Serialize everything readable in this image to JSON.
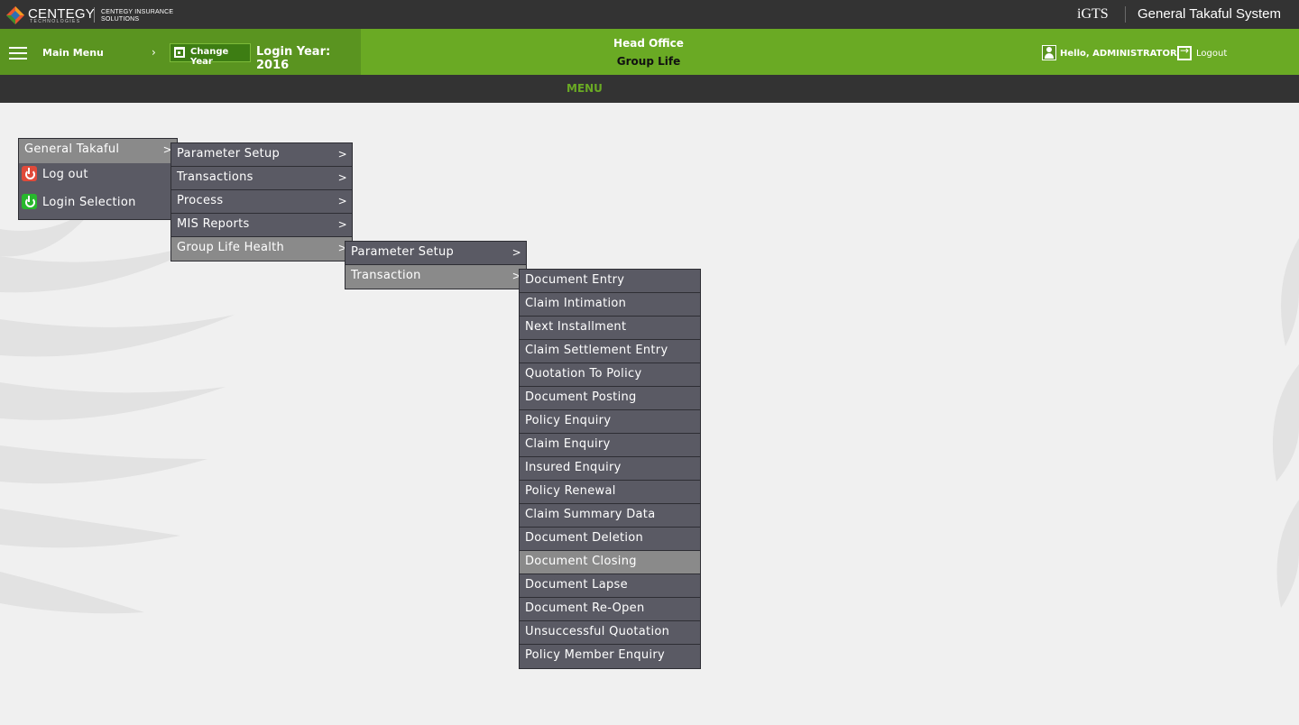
{
  "header": {
    "brand": "CENTEGY",
    "brand_sub": "TECHNOLOGIES",
    "company": "CENTEGY INSURANCE SOLUTIONS",
    "product_short": "iGTS",
    "product_name": "General Takaful System"
  },
  "greenbar": {
    "main_menu_label": "Main Menu",
    "change_year_label": "Change Year",
    "login_year": "Login Year: 2016",
    "office": "Head Office",
    "group": "Group Life",
    "hello": "Hello, ADMINISTRATOR",
    "logout_label": "Logout"
  },
  "menu_strip": {
    "label": "MENU"
  },
  "colors": {
    "accent": "#6aaa24",
    "dark": "#333333",
    "menu_bg": "#5a5a64",
    "menu_active": "#8a8a8a"
  },
  "menu1": [
    {
      "label": "General Takaful",
      "arrow": ">"
    },
    {
      "label": "Log out",
      "icon": "power-red-icon"
    },
    {
      "label": "Login Selection",
      "icon": "power-green-icon"
    }
  ],
  "menu2": [
    {
      "label": "Parameter Setup",
      "arrow": ">"
    },
    {
      "label": "Transactions",
      "arrow": ">"
    },
    {
      "label": "Process",
      "arrow": ">"
    },
    {
      "label": "MIS Reports",
      "arrow": ">"
    },
    {
      "label": "Group Life Health",
      "arrow": ">"
    }
  ],
  "menu3": [
    {
      "label": "Parameter Setup",
      "arrow": ">"
    },
    {
      "label": "Transaction",
      "arrow": ">"
    }
  ],
  "menu4": [
    {
      "label": "Document Entry"
    },
    {
      "label": "Claim Intimation"
    },
    {
      "label": "Next Installment"
    },
    {
      "label": "Claim Settlement Entry"
    },
    {
      "label": "Quotation To Policy"
    },
    {
      "label": "Document Posting"
    },
    {
      "label": "Policy Enquiry"
    },
    {
      "label": "Claim Enquiry"
    },
    {
      "label": "Insured Enquiry"
    },
    {
      "label": "Policy Renewal"
    },
    {
      "label": "Claim Summary Data"
    },
    {
      "label": "Document Deletion"
    },
    {
      "label": "Document Closing"
    },
    {
      "label": "Document Lapse"
    },
    {
      "label": "Document Re-Open"
    },
    {
      "label": "Unsuccessful Quotation"
    },
    {
      "label": "Policy Member Enquiry"
    }
  ]
}
